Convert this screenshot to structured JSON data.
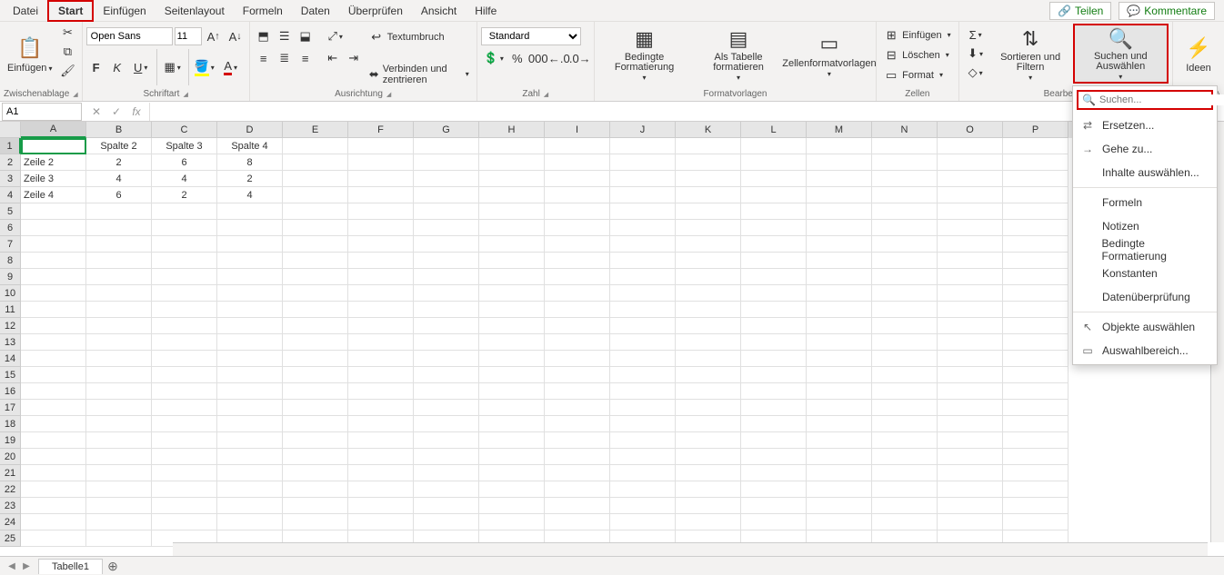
{
  "tabs": {
    "datei": "Datei",
    "start": "Start",
    "einfuegen": "Einfügen",
    "seitenlayout": "Seitenlayout",
    "formeln": "Formeln",
    "daten": "Daten",
    "ueberpruefen": "Überprüfen",
    "ansicht": "Ansicht",
    "hilfe": "Hilfe"
  },
  "topright": {
    "teilen": "Teilen",
    "kommentare": "Kommentare"
  },
  "ribbon": {
    "zwischenablage": {
      "label": "Zwischenablage",
      "einfuegen": "Einfügen"
    },
    "schriftart": {
      "label": "Schriftart",
      "font_name": "Open Sans",
      "font_size": "11",
      "bold": "F",
      "italic": "K",
      "underline": "U"
    },
    "ausrichtung": {
      "label": "Ausrichtung",
      "textumbruch": "Textumbruch",
      "verbinden": "Verbinden und zentrieren"
    },
    "zahl": {
      "label": "Zahl",
      "format": "Standard"
    },
    "formatvorlagen": {
      "label": "Formatvorlagen",
      "bedingte": "Bedingte Formatierung",
      "als_tabelle": "Als Tabelle formatieren",
      "zellen": "Zellenformatvorlagen"
    },
    "zellen": {
      "label": "Zellen",
      "einfuegen": "Einfügen",
      "loeschen": "Löschen",
      "format": "Format"
    },
    "bearbeiten": {
      "label": "Bearbeiten",
      "sortieren": "Sortieren und Filtern",
      "suchen": "Suchen und Auswählen"
    },
    "ideen": {
      "label": "Ideen",
      "btn": "Ideen"
    }
  },
  "namebox": "A1",
  "columns": [
    "A",
    "B",
    "C",
    "D",
    "E",
    "F",
    "G",
    "H",
    "I",
    "J",
    "K",
    "L",
    "M",
    "N",
    "O",
    "P"
  ],
  "rows": [
    "1",
    "2",
    "3",
    "4",
    "5",
    "6",
    "7",
    "8",
    "9",
    "10",
    "11",
    "12",
    "13",
    "14",
    "15",
    "16",
    "17",
    "18",
    "19",
    "20",
    "21",
    "22",
    "23",
    "24",
    "25"
  ],
  "cells": {
    "B1": "Spalte 2",
    "C1": "Spalte 3",
    "D1": "Spalte 4",
    "A2": "Zeile 2",
    "B2": "2",
    "C2": "6",
    "D2": "8",
    "A3": "Zeile 3",
    "B3": "4",
    "C3": "4",
    "D3": "2",
    "A4": "Zeile 4",
    "B4": "6",
    "C4": "2",
    "D4": "4"
  },
  "sheet": {
    "tab1": "Tabelle1"
  },
  "menu": {
    "search_placeholder": "Suchen...",
    "ersetzen": "Ersetzen...",
    "gehe_zu": "Gehe zu...",
    "inhalte": "Inhalte auswählen...",
    "formeln": "Formeln",
    "notizen": "Notizen",
    "bedingte": "Bedingte Formatierung",
    "konstanten": "Konstanten",
    "datenueberpruefung": "Datenüberprüfung",
    "objekte": "Objekte auswählen",
    "auswahlbereich": "Auswahlbereich..."
  }
}
